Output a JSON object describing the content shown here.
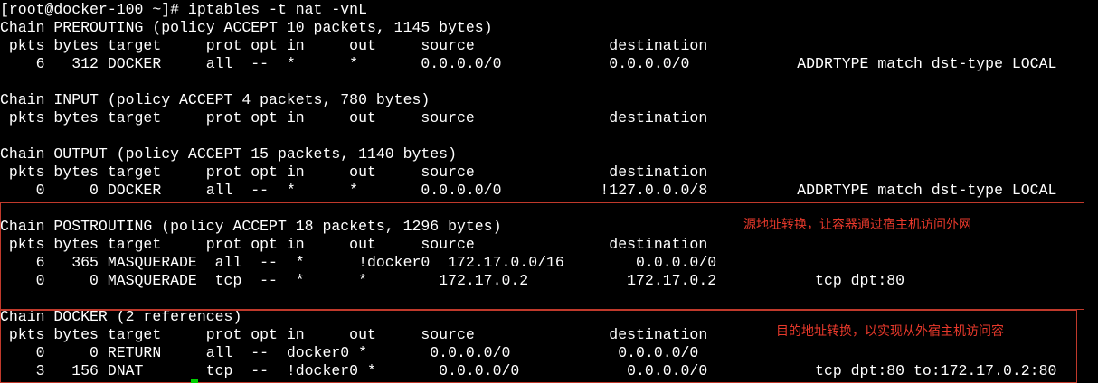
{
  "terminal": {
    "lines": [
      "[root@docker-100 ~]# iptables -t nat -vnL",
      "Chain PREROUTING (policy ACCEPT 10 packets, 1145 bytes)",
      " pkts bytes target     prot opt in     out     source               destination",
      "    6   312 DOCKER     all  --  *      *       0.0.0.0/0            0.0.0.0/0            ADDRTYPE match dst-type LOCAL",
      "",
      "Chain INPUT (policy ACCEPT 4 packets, 780 bytes)",
      " pkts bytes target     prot opt in     out     source               destination",
      "",
      "Chain OUTPUT (policy ACCEPT 15 packets, 1140 bytes)",
      " pkts bytes target     prot opt in     out     source               destination",
      "    0     0 DOCKER     all  --  *      *       0.0.0.0/0           !127.0.0.0/8          ADDRTYPE match dst-type LOCAL",
      "",
      "Chain POSTROUTING (policy ACCEPT 18 packets, 1296 bytes)",
      " pkts bytes target     prot opt in     out     source               destination",
      "    6   365 MASQUERADE  all  --  *      !docker0  172.17.0.0/16        0.0.0.0/0",
      "    0     0 MASQUERADE  tcp  --  *      *        172.17.0.2           172.17.0.2           tcp dpt:80",
      "",
      "Chain DOCKER (2 references)",
      " pkts bytes target     prot opt in     out     source               destination",
      "    0     0 RETURN     all  --  docker0 *       0.0.0.0/0            0.0.0.0/0",
      "    3   156 DNAT       tcp  --  !docker0 *       0.0.0.0/0            0.0.0.0/0            tcp dpt:80 to:172.17.0.2:80"
    ]
  },
  "annotations": {
    "snat_note": "源地址转换，让容器通过宿主机访问外网",
    "dnat_note": "目的地址转换，以实现从外宿主机访问容"
  },
  "colors": {
    "background": "#000000",
    "text": "#ffffff",
    "annotation": "#e8392b",
    "box_border": "#c0392b",
    "cursor": "#00d000"
  }
}
